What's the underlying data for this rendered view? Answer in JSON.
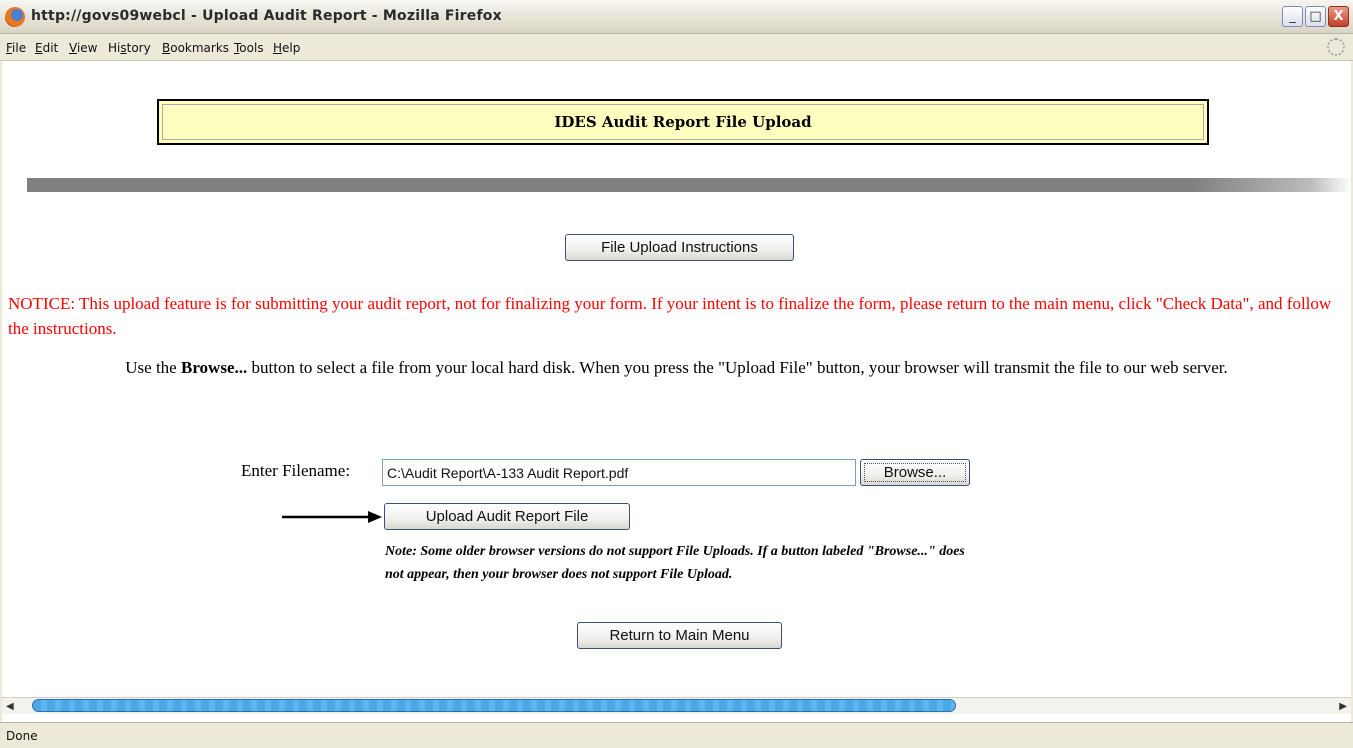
{
  "window": {
    "title": "http://govs09webcl - Upload Audit Report - Mozilla Firefox",
    "controls": [
      "_",
      "□",
      "X"
    ]
  },
  "menu": [
    {
      "label": "File",
      "accel": "F",
      "rest": "ile"
    },
    {
      "label": "Edit",
      "accel": "E",
      "rest": "dit"
    },
    {
      "label": "View",
      "accel": "V",
      "rest": "iew"
    },
    {
      "label": "History",
      "pre": "Hi",
      "accel": "s",
      "rest": "tory"
    },
    {
      "label": "Bookmarks",
      "accel": "B",
      "rest": "ookmarks"
    },
    {
      "label": "Tools",
      "accel": "T",
      "rest": "ools"
    },
    {
      "label": "Help",
      "accel": "H",
      "rest": "elp"
    }
  ],
  "page": {
    "banner_title": "IDES Audit Report File Upload",
    "instructions_button": "File Upload Instructions",
    "notice": "NOTICE: This upload feature is for submitting your audit report, not for finalizing your form. If your intent is to finalize the form, please return to the main menu, click \"Check Data\", and follow the instructions.",
    "description_pre": "Use the ",
    "description_bold": "Browse...",
    "description_post": " button to select a file from your local hard disk. When you press the \"Upload File\" button, your browser will transmit the file to our web server.",
    "filename_label": "Enter Filename:",
    "filename_value": "C:\\Audit Report\\A-133 Audit Report.pdf",
    "browse_button": "Browse...",
    "upload_button": "Upload Audit Report File",
    "note_line1": "Note: Some older browser versions do not support File Uploads. If a button labeled \"Browse...\" does",
    "note_line2": "not appear, then your browser does not support File Upload.",
    "return_button": "Return to Main Menu"
  },
  "status": {
    "text": "Done"
  },
  "colors": {
    "banner_bg": "#ffffc0",
    "notice_text": "#ff0000",
    "divider": "#808080",
    "scroll_thumb": "#4aa8e6"
  }
}
